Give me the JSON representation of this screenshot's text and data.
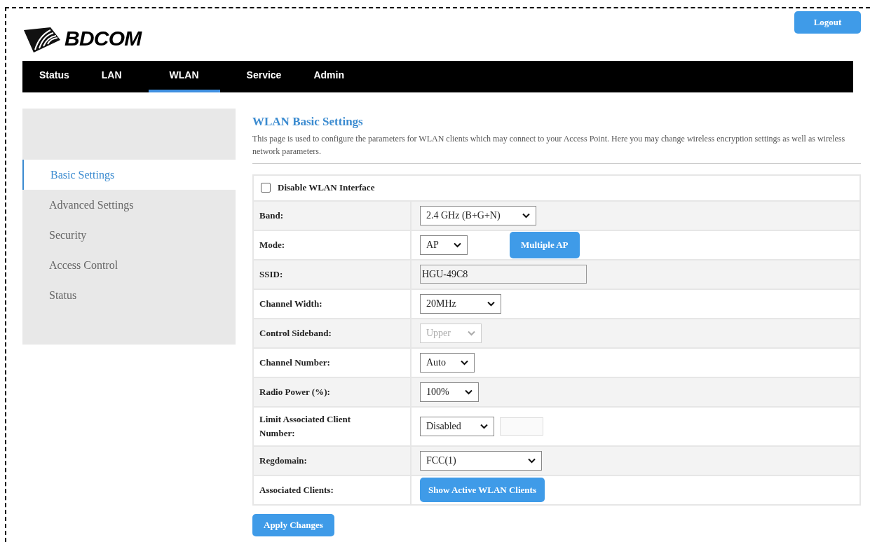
{
  "header": {
    "brand": "BDCOM",
    "logout": "Logout"
  },
  "nav": [
    {
      "label": "Status",
      "selected": false
    },
    {
      "label": "LAN",
      "selected": false
    },
    {
      "label": "WLAN",
      "selected": true
    },
    {
      "label": "Service",
      "selected": false
    },
    {
      "label": "Admin",
      "selected": false
    }
  ],
  "sidebar": {
    "items": [
      {
        "label": "Basic Settings",
        "selected": true
      },
      {
        "label": "Advanced Settings",
        "selected": false
      },
      {
        "label": "Security",
        "selected": false
      },
      {
        "label": "Access Control",
        "selected": false
      },
      {
        "label": "Status",
        "selected": false
      }
    ]
  },
  "page": {
    "title": "WLAN Basic Settings",
    "description": "This page is used to configure the parameters for WLAN clients which may connect to your Access Point. Here you may change wireless encryption settings as well as wireless network parameters."
  },
  "disable_wlan": {
    "label": "Disable WLAN Interface",
    "checked": false
  },
  "rows": [
    {
      "kind": "select",
      "label": "Band:",
      "value": "2.4 GHz (B+G+N)",
      "disabled": false
    },
    {
      "kind": "select_button",
      "label": "Mode:",
      "value": "AP",
      "disabled": false,
      "button": "Multiple AP"
    },
    {
      "kind": "text",
      "label": "SSID:",
      "value": "HGU-49C8"
    },
    {
      "kind": "select",
      "label": "Channel Width:",
      "value": "20MHz",
      "disabled": false
    },
    {
      "kind": "select",
      "label": "Control Sideband:",
      "value": "Upper",
      "disabled": true
    },
    {
      "kind": "select",
      "label": "Channel Number:",
      "value": "Auto",
      "disabled": false
    },
    {
      "kind": "select",
      "label": "Radio Power (%):",
      "value": "100%",
      "disabled": false
    },
    {
      "kind": "select_input",
      "label": "Limit Associated Client Number:",
      "value": "Disabled",
      "disabled": false
    },
    {
      "kind": "select",
      "label": "Regdomain:",
      "value": "FCC(1)",
      "disabled": false
    },
    {
      "kind": "button",
      "label": "Associated Clients:",
      "button": "Show Active WLAN Clients"
    }
  ],
  "apply": "Apply Changes"
}
